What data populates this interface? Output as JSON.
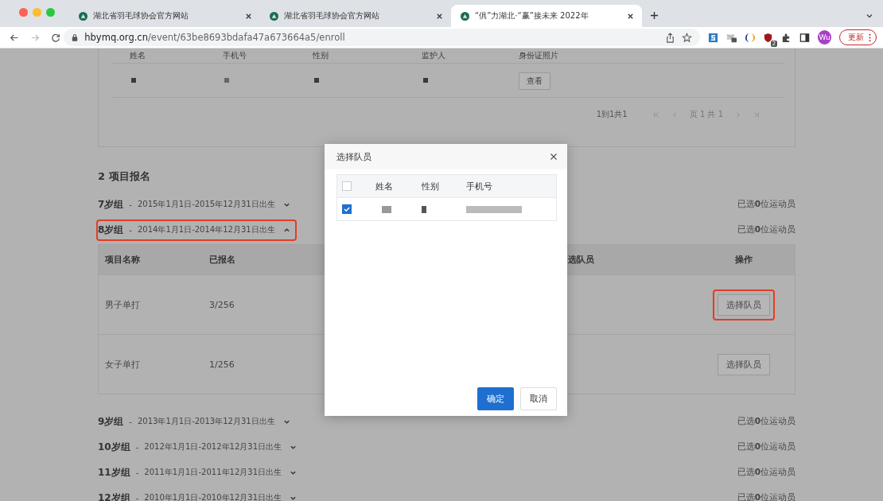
{
  "browser": {
    "tabs": [
      {
        "title": "湖北省羽毛球协会官方网站",
        "selected": false
      },
      {
        "title": "湖北省羽毛球协会官方网站",
        "selected": false
      },
      {
        "title": "“俱”力湖北·“赢”接未来 2022年",
        "selected": true
      }
    ],
    "url": {
      "host": "hbymq.org.cn",
      "path": "/event/63be8693bdafa47a673664a5/enroll"
    },
    "extension_badge": "2",
    "avatar": "Wu",
    "update_label": "更新"
  },
  "top_card": {
    "columns": [
      "姓名",
      "手机号",
      "性别",
      "监护人",
      "身份证照片"
    ],
    "rows": [
      {
        "action": "查看"
      }
    ],
    "pagination": {
      "summary": "1到1共1",
      "page": "页 1 共 1"
    }
  },
  "section_title": "2 项目报名",
  "groups": [
    {
      "name": "7岁组",
      "separator": "-",
      "dates": "2015年1月1日-2015年12月31日出生",
      "expanded": false,
      "highlighted": false,
      "selected_count": "已选**0**位运动员"
    },
    {
      "name": "8岁组",
      "separator": "-",
      "dates": "2014年1月1日-2014年12月31日出生",
      "expanded": true,
      "highlighted": true,
      "selected_count": "已选**0**位运动员",
      "table": {
        "columns": [
          "项目名称",
          "已报名",
          "",
          "选队员",
          "操作"
        ],
        "rows": [
          {
            "event": "男子单打",
            "registered": "3/256",
            "action": "选择队员",
            "highlighted": true
          },
          {
            "event": "女子单打",
            "registered": "1/256",
            "action": "选择队员",
            "highlighted": false
          }
        ]
      }
    },
    {
      "name": "9岁组",
      "separator": "-",
      "dates": "2013年1月1日-2013年12月31日出生",
      "expanded": false,
      "highlighted": false,
      "selected_count": "已选**0**位运动员"
    },
    {
      "name": "10岁组",
      "separator": "-",
      "dates": "2012年1月1日-2012年12月31日出生",
      "expanded": false,
      "highlighted": false,
      "selected_count": "已选**0**位运动员"
    },
    {
      "name": "11岁组",
      "separator": "-",
      "dates": "2011年1月1日-2011年12月31日出生",
      "expanded": false,
      "highlighted": false,
      "selected_count": "已选**0**位运动员"
    },
    {
      "name": "12岁组",
      "separator": "-",
      "dates": "2010年1月1日-2010年12月31日出生",
      "expanded": false,
      "highlighted": false,
      "selected_count": "已选**0**位运动员"
    }
  ],
  "modal": {
    "title": "选择队员",
    "columns": [
      "姓名",
      "性别",
      "手机号"
    ],
    "header_checked": false,
    "rows": [
      {
        "checked": true
      }
    ],
    "buttons": [
      {
        "label": "确定",
        "kind": "primary"
      },
      {
        "label": "取消",
        "kind": "default"
      }
    ]
  }
}
